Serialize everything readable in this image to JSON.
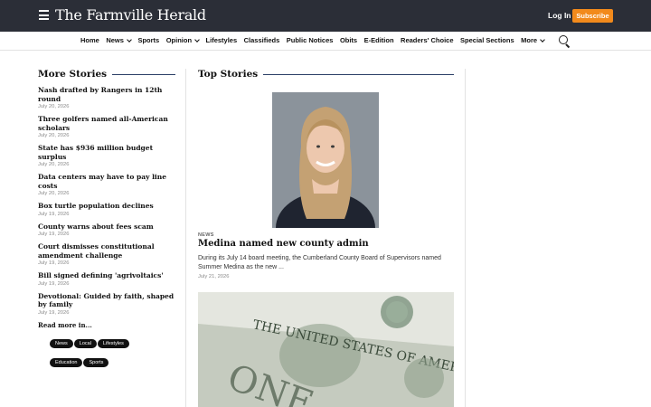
{
  "header": {
    "masthead": "The Farmville Herald",
    "login_label": "Log In",
    "subscribe_label": "Subscribe",
    "menu_icon": "hamburger-menu-icon",
    "search_icon": "search-icon",
    "bar_color": "#2b2e37",
    "subscribe_color": "#f28a1c"
  },
  "nav": {
    "items": [
      {
        "label": "Home"
      },
      {
        "label": "News",
        "dropdown": true
      },
      {
        "label": "Sports"
      },
      {
        "label": "Opinion",
        "dropdown": true
      },
      {
        "label": "Lifestyles"
      },
      {
        "label": "Classifieds"
      },
      {
        "label": "Public Notices"
      },
      {
        "label": "Obits"
      },
      {
        "label": "E-Edition"
      },
      {
        "label": "Readers' Choice"
      },
      {
        "label": "Special Sections"
      },
      {
        "label": "More",
        "dropdown": true
      }
    ]
  },
  "more_stories": {
    "title": "More Stories",
    "items": [
      {
        "title": "Nash drafted by Rangers in 12th round",
        "date": "July 20, 2026"
      },
      {
        "title": "Three golfers named all-American scholars",
        "date": "July 20, 2026"
      },
      {
        "title": "State has $936 million budget surplus",
        "date": "July 20, 2026"
      },
      {
        "title": "Data centers may have to pay line costs",
        "date": "July 20, 2026"
      },
      {
        "title": "Box turtle population declines",
        "date": "July 19, 2026"
      },
      {
        "title": "County warns about fees scam",
        "date": "July 19, 2026"
      },
      {
        "title": "Court dismisses constitutional amendment challenge",
        "date": "July 19, 2026"
      },
      {
        "title": "Bill signed defining 'agrivoltaics'",
        "date": "July 19, 2026"
      },
      {
        "title": "Devotional: Guided by faith, shaped by family",
        "date": "July 19, 2026"
      }
    ],
    "read_more_label": "Read more in...",
    "tags": [
      "News",
      "Local",
      "Lifestyles",
      "Education",
      "Sports"
    ]
  },
  "top_stories": {
    "title": "Top Stories",
    "lead": {
      "kicker": "NEWS",
      "headline": "Medina named new county admin",
      "summary": "During its July 14 board meeting, the Cumberland County Board of Supervisors named Summer Medina as the new ...",
      "date": "July 21, 2026"
    }
  },
  "accent_rule_color": "#2b3f66"
}
